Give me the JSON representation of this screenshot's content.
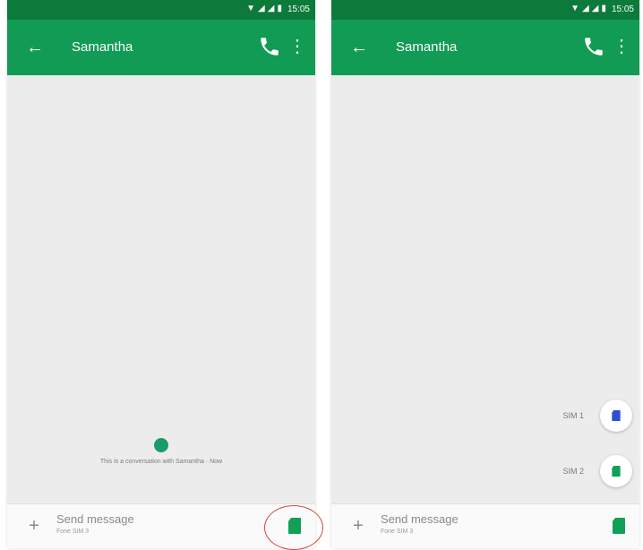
{
  "colors": {
    "statusbar": "#0b7a3a",
    "appbar": "#119b54",
    "sim1": "#2d4fd1",
    "sim2": "#11a058",
    "highlight": "#dd4444"
  },
  "status": {
    "time": "15:05",
    "icons": [
      "wifi-icon",
      "signal-icon",
      "signal-icon",
      "battery-icon"
    ]
  },
  "left": {
    "title": "Samantha",
    "conversation_info": "This is a conversation with Samantha · Now",
    "compose_placeholder": "Send message",
    "compose_sub": "Fone SIM 3"
  },
  "right": {
    "title": "Samantha",
    "compose_placeholder": "Send message",
    "compose_sub": "Fone SIM 3",
    "sim_options": [
      {
        "label": "SIM 1"
      },
      {
        "label": "SIM 2"
      }
    ]
  }
}
